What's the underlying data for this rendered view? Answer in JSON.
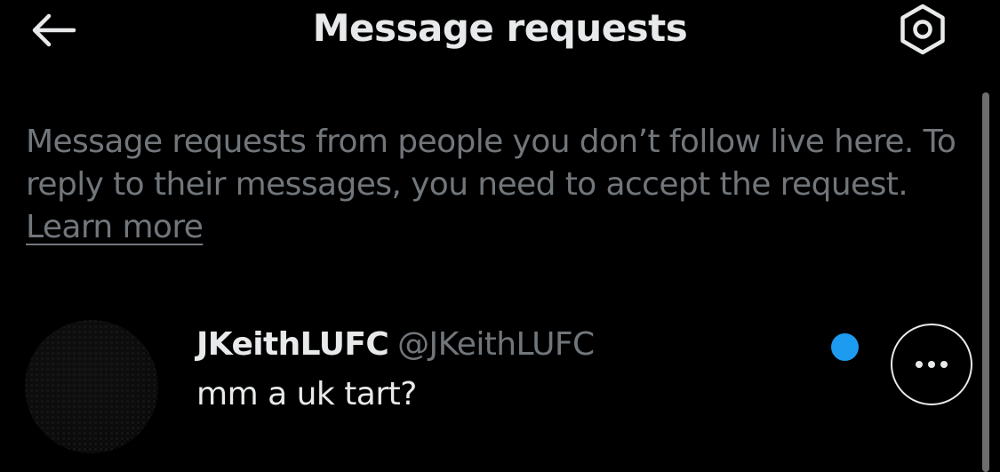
{
  "header": {
    "title": "Message requests",
    "back_icon": "arrow-left-icon",
    "settings_icon": "gear-icon"
  },
  "info": {
    "text": "Message requests from people you don’t follow live here. To reply to their messages, you need to accept the request.",
    "learn_more": "Learn more"
  },
  "requests": [
    {
      "display_name": "JKeithLUFC",
      "handle": "@JKeithLUFC",
      "message": "mm a uk tart?",
      "unread": true,
      "more_icon": "more-horizontal-icon"
    }
  ],
  "colors": {
    "background": "#000000",
    "primary_text": "#e7e9ea",
    "secondary_text": "#71767b",
    "accent": "#1d9bf0"
  }
}
